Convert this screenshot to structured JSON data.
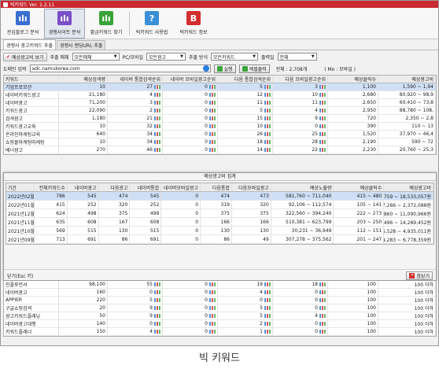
{
  "window": {
    "title": "빅키워드 Ver. 1.2.11"
  },
  "toolbar": {
    "items": [
      {
        "label": "관심블로그 분석",
        "icon": "blog-analysis-icon",
        "color": "#3a6fd0",
        "glyph": "ılı"
      },
      {
        "label": "경쟁사이트 분석",
        "icon": "competitor-analysis-icon",
        "color": "#7a4fc8",
        "glyph": "ılı"
      },
      {
        "label": "황금키워드 찾기",
        "icon": "golden-keyword-icon",
        "color": "#3aa43a",
        "glyph": "ılı"
      },
      {
        "label": "빅키워드 사용법",
        "icon": "help-icon",
        "color": "#3a8fd6",
        "glyph": "?"
      },
      {
        "label": "빅키워드 정보",
        "icon": "info-icon",
        "color": "#d32f2f",
        "glyph": "B"
      }
    ]
  },
  "subtabs": [
    "경쟁사 광고키워드 추출",
    "경쟁사 랜딩URL 추출"
  ],
  "filters": {
    "ad_cost_btn": "예상광고비 보기",
    "media_label": "추출 매체",
    "media_value": "모든매체",
    "device_label": "PC/모바일",
    "device_value": "모든광고",
    "method_label": "추출 방식",
    "method_value": "모든키워드",
    "result_label": "출력일",
    "result_value": "전체"
  },
  "domain": {
    "label": "도메인 입력",
    "value": "adc.namukorea.com",
    "run": "실행",
    "excel": "엑셀출력",
    "total": "전체 : 2,708개",
    "mode": "( Mo : 모바일 )"
  },
  "grid": {
    "headers": [
      "키워드",
      "예상검색량",
      "네이버 통합검색순위",
      "네이버 모바일광고순위",
      "다음 통합검색순위",
      "다음 모바일광고순위",
      "예상클릭수",
      "예상광고비"
    ],
    "rows": [
      [
        "기업프로모션",
        "10",
        "27",
        "0",
        "5",
        "3",
        "1,100",
        "1,590 ~ 1,94"
      ],
      [
        "네이버키워드광고",
        "21,180",
        "4",
        "0",
        "12",
        "10",
        "2,680",
        "80,920 ~ 98,9"
      ],
      [
        "네이버광고",
        "71,200",
        "3",
        "0",
        "11",
        "11",
        "2,650",
        "60,410 ~ 73,8"
      ],
      [
        "키워드광고",
        "22,090",
        "2",
        "0",
        "5",
        "4",
        "2,950",
        "88,780 ~ 108,"
      ],
      [
        "검색광고",
        "1,180",
        "21",
        "0",
        "15",
        "9",
        "720",
        "2,350 ~ 2,8"
      ],
      [
        "키워드광고교육",
        "10",
        "32",
        "0",
        "10",
        "0",
        "390",
        "110 ~ 13"
      ],
      [
        "온라인마케팅교육",
        "640",
        "34",
        "0",
        "26",
        "25",
        "1,520",
        "37,970 ~ 46,4"
      ],
      [
        "쇼핑몰마케팅마케팅",
        "10",
        "34",
        "0",
        "18",
        "28",
        "2,190",
        "590 ~ 72"
      ],
      [
        "배너광고",
        "270",
        "46",
        "0",
        "14",
        "22",
        "2,230",
        "20,760 ~ 25,3"
      ]
    ]
  },
  "modal": {
    "title": "예상광고비 집계",
    "headers": [
      "기간",
      "전체키워드수",
      "네이버광고",
      "다음광고",
      "네이버통합",
      "네이버모바일광고",
      "다음통합",
      "다음모바일광고",
      "예상노출량",
      "예상클릭수",
      "예상광고비"
    ],
    "rows": [
      [
        "2022년02월",
        "786",
        "545",
        "474",
        "545",
        "0",
        "474",
        "473",
        "581,760 ~ 711,040",
        "415 ~ 480",
        "14,254,759 ~ 18,533,057원"
      ],
      [
        "2022년01월",
        "415",
        "252",
        "320",
        "252",
        "0",
        "319",
        "320",
        "92,106 ~ 112,574",
        "105 ~ 141",
        "2,047,266 ~ 2,372,088원"
      ],
      [
        "2021년12월",
        "624",
        "498",
        "375",
        "498",
        "0",
        "375",
        "375",
        "322,560 ~ 394,240",
        "222 ~ 273",
        "9,447,860 ~ 11,090,966원"
      ],
      [
        "2021년11월",
        "635",
        "608",
        "167",
        "608",
        "0",
        "166",
        "166",
        "510,381 ~ 623,799",
        "203 ~ 250",
        "12,172,496 ~ 14,289,452원"
      ],
      [
        "2021년10월",
        "569",
        "515",
        "130",
        "515",
        "0",
        "130",
        "130",
        "30,231 ~ 36,949",
        "112 ~ 151",
        "4,326,528 ~ 4,935,011원"
      ],
      [
        "2021년09월",
        "713",
        "691",
        "86",
        "691",
        "0",
        "86",
        "49",
        "307,278 ~ 375,562",
        "201 ~ 247",
        "5,844,283 ~ 6,778,359원"
      ]
    ],
    "close_hint": "닫기(Esc 키)",
    "close_btn": "창닫기"
  },
  "grid2": {
    "rows": [
      [
        "인플루언서",
        "98,100",
        "55",
        "0",
        "19",
        "18",
        "100",
        "100 이하"
      ],
      [
        "네이버광고",
        "160",
        "0",
        "0",
        "4",
        "0",
        "100",
        "100 이하"
      ],
      [
        "APPIER",
        "220",
        "5",
        "0",
        "0",
        "0",
        "100",
        "100 이하"
      ],
      [
        "구글쇼핑검색",
        "20",
        "9",
        "0",
        "5",
        "0",
        "100",
        "100 이하"
      ],
      [
        "광고키워드플래닝",
        "50",
        "9",
        "0",
        "5",
        "4",
        "100",
        "100 이하"
      ],
      [
        "네이버광고대행",
        "140",
        "0",
        "0",
        "2",
        "0",
        "100",
        "100 이하"
      ],
      [
        "키워드플래너",
        "150",
        "4",
        "0",
        "1",
        "0",
        "100",
        "100 이하"
      ]
    ]
  },
  "caption": "빅 키워드"
}
